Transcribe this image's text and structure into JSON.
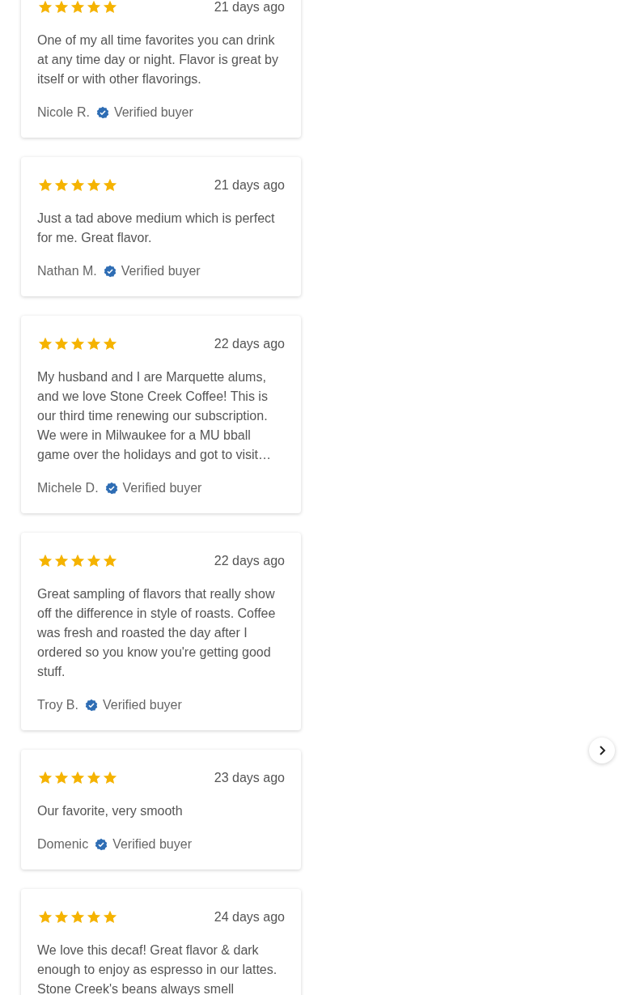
{
  "reviews": [
    {
      "stars": 5,
      "date": "21 days ago",
      "body": "One of my all time favorites you can drink at any time day or night. Flavor is great by itself or with other flavorings.",
      "author": "Nicole R.",
      "verified": true,
      "verified_label": "Verified buyer"
    },
    {
      "stars": 5,
      "date": "21 days ago",
      "body": "Just a tad above medium which is perfect for me. Great flavor.",
      "author": "Nathan M.",
      "verified": true,
      "verified_label": "Verified buyer"
    },
    {
      "stars": 5,
      "date": "22 days ago",
      "body": "My husband and I are Marquette alums, and we love Stone Creek Coffee! This is our third time renewing our subscription. We were in Milwaukee for a MU bball game over the holidays and got to visit…",
      "author": "Michele D.",
      "verified": true,
      "verified_label": "Verified buyer"
    },
    {
      "stars": 5,
      "date": "22 days ago",
      "body": "Great sampling of flavors that really show off the difference in style of roasts. Coffee was fresh and roasted the day after I ordered so you know you're getting good stuff.",
      "author": "Troy B.",
      "verified": true,
      "verified_label": "Verified buyer"
    },
    {
      "stars": 5,
      "date": "23 days ago",
      "body": "Our favorite, very smooth",
      "author": "Domenic",
      "verified": true,
      "verified_label": "Verified buyer"
    },
    {
      "stars": 5,
      "date": "24 days ago",
      "body": "We love this decaf! Great flavor & dark enough to enjoy as espresso in our lattes. Stone Creek's beans always smell"
    }
  ]
}
